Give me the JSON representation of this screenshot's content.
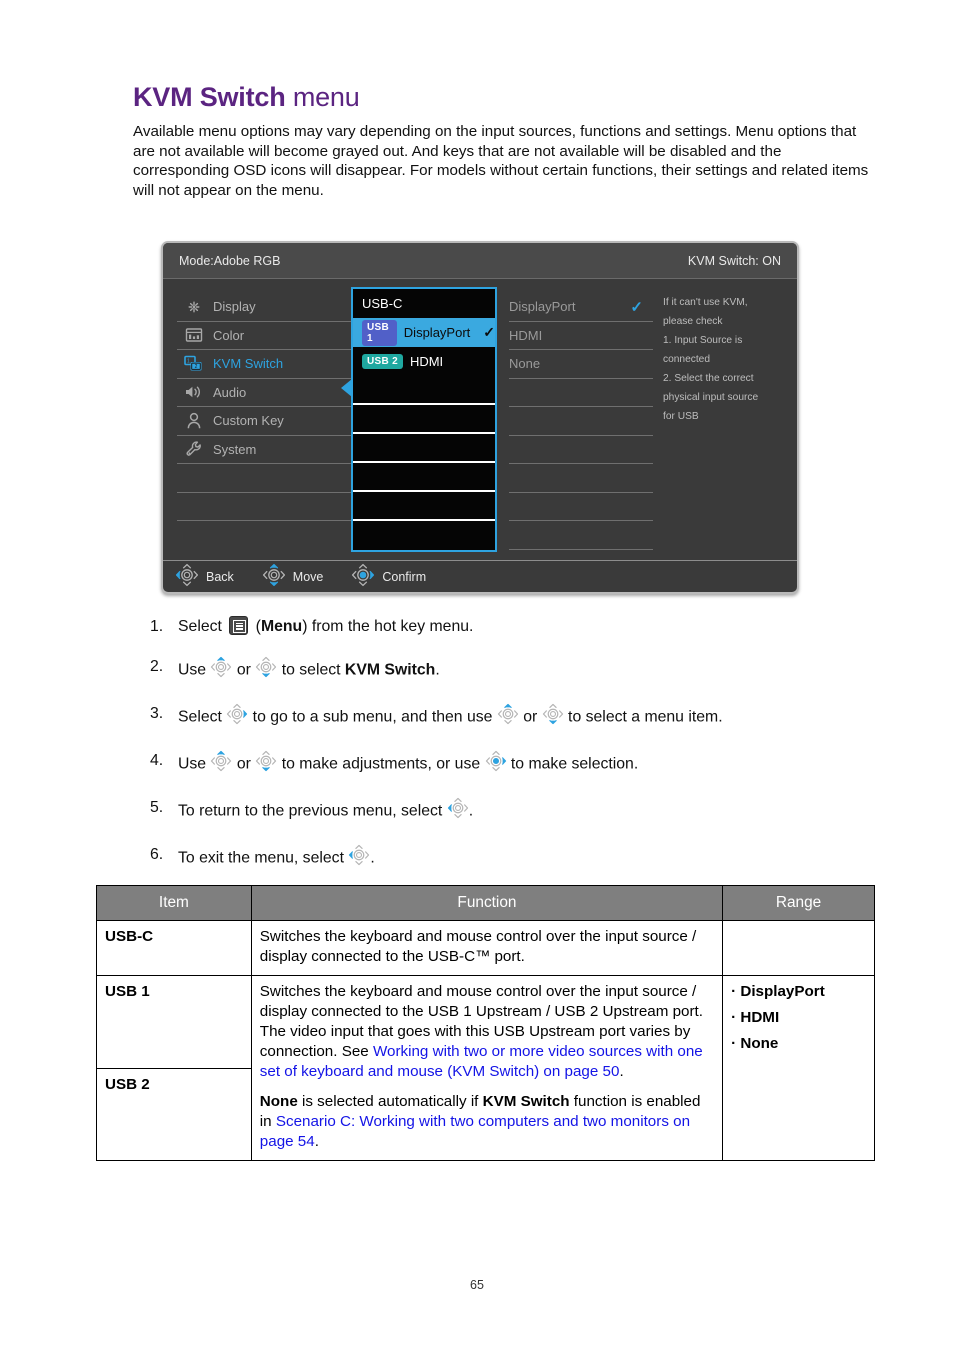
{
  "page": {
    "title_bold": "KVM Switch",
    "title_rest": " menu",
    "intro": "Available menu options may vary depending on the input sources, functions and settings. Menu options that are not available will become grayed out. And keys that are not available will be disabled and the corresponding OSD icons will disappear. For models without certain functions, their settings and related items will not appear on the menu.",
    "number": "65"
  },
  "osd": {
    "mode_label": "Mode:Adobe RGB",
    "kvm_status": "KVM Switch: ON",
    "sidebar": [
      {
        "label": "Display",
        "icon": "brightness-icon",
        "active": false
      },
      {
        "label": "Color",
        "icon": "color-chart-icon",
        "active": false
      },
      {
        "label": "KVM Switch",
        "icon": "kvm-monitors-icon",
        "active": true
      },
      {
        "label": "Audio",
        "icon": "speaker-icon",
        "active": false
      },
      {
        "label": "Custom Key",
        "icon": "person-icon",
        "active": false
      },
      {
        "label": "System",
        "icon": "wrench-icon",
        "active": false
      }
    ],
    "middle_items": [
      {
        "badge": "",
        "label": "USB-C",
        "selected": false,
        "check": false
      },
      {
        "badge": "USB 1",
        "badge_style": "u1",
        "label": "DisplayPort",
        "selected": true,
        "check": true
      },
      {
        "badge": "USB 2",
        "badge_style": "u2",
        "label": "HDMI",
        "selected": false,
        "check": false
      }
    ],
    "right_items": [
      {
        "label": "DisplayPort",
        "check": true
      },
      {
        "label": "HDMI",
        "check": false
      },
      {
        "label": "None",
        "check": false
      }
    ],
    "hint_lines": [
      "If it can't use KVM,",
      "please check",
      "1. Input Source is",
      "connected",
      "2. Select the correct",
      "physical input source",
      "for USB"
    ],
    "bottom_actions": [
      {
        "label": "Back",
        "key": "left"
      },
      {
        "label": "Move",
        "key": "updown"
      },
      {
        "label": "Confirm",
        "key": "center"
      }
    ],
    "colors": {
      "accent": "#2ea3e0",
      "selected_row": "#3aa9e0",
      "usb1_badge": "#5160c8",
      "usb2_badge": "#1fa8a0",
      "panel_bg": "#3a3a3a"
    }
  },
  "steps": [
    {
      "num": "1.",
      "parts": [
        {
          "t": "text",
          "v": "Select "
        },
        {
          "t": "menuicon"
        },
        {
          "t": "text",
          "v": " ("
        },
        {
          "t": "bold",
          "v": "Menu"
        },
        {
          "t": "text",
          "v": ") from the hot key menu."
        }
      ]
    },
    {
      "num": "2.",
      "parts": [
        {
          "t": "text",
          "v": "Use "
        },
        {
          "t": "ctl",
          "v": "up"
        },
        {
          "t": "text",
          "v": " or "
        },
        {
          "t": "ctl",
          "v": "down"
        },
        {
          "t": "text",
          "v": " to select "
        },
        {
          "t": "bold",
          "v": "KVM Switch"
        },
        {
          "t": "text",
          "v": "."
        }
      ]
    },
    {
      "num": "3.",
      "parts": [
        {
          "t": "text",
          "v": "Select "
        },
        {
          "t": "ctl",
          "v": "right"
        },
        {
          "t": "text",
          "v": " to go to a sub menu, and then use "
        },
        {
          "t": "ctl",
          "v": "up"
        },
        {
          "t": "text",
          "v": " or "
        },
        {
          "t": "ctl",
          "v": "down"
        },
        {
          "t": "text",
          "v": " to select a menu item."
        }
      ]
    },
    {
      "num": "4.",
      "parts": [
        {
          "t": "text",
          "v": "Use "
        },
        {
          "t": "ctl",
          "v": "up"
        },
        {
          "t": "text",
          "v": " or "
        },
        {
          "t": "ctl",
          "v": "down"
        },
        {
          "t": "text",
          "v": " to make adjustments, or use "
        },
        {
          "t": "ctl",
          "v": "center"
        },
        {
          "t": "text",
          "v": " to make selection."
        }
      ]
    },
    {
      "num": "5.",
      "parts": [
        {
          "t": "text",
          "v": "To return to the previous menu, select "
        },
        {
          "t": "ctl",
          "v": "left"
        },
        {
          "t": "text",
          "v": "."
        }
      ]
    },
    {
      "num": "6.",
      "parts": [
        {
          "t": "text",
          "v": "To exit the menu, select "
        },
        {
          "t": "ctl",
          "v": "left"
        },
        {
          "t": "text",
          "v": "."
        }
      ]
    }
  ],
  "table": {
    "headers": [
      "Item",
      "Function",
      "Range"
    ],
    "rows": [
      {
        "item": "USB-C",
        "function_parts": [
          {
            "t": "text",
            "v": "Switches the keyboard and mouse control over the input source / display connected to the USB-C™ port."
          }
        ],
        "range": []
      },
      {
        "item": "USB 1",
        "item2": "USB 2",
        "function_parts": [
          {
            "t": "para",
            "parts": [
              {
                "t": "text",
                "v": "Switches the keyboard and mouse control over the input source / display connected to the USB 1 Upstream / USB 2 Upstream port. The video input that goes with this USB Upstream port varies by connection. See "
              },
              {
                "t": "link",
                "v": "Working with two or more video sources with one set of keyboard and mouse (KVM Switch) on page 50"
              },
              {
                "t": "text",
                "v": "."
              }
            ]
          },
          {
            "t": "para",
            "parts": [
              {
                "t": "bold",
                "v": "None"
              },
              {
                "t": "text",
                "v": " is selected automatically if "
              },
              {
                "t": "bold",
                "v": "KVM Switch"
              },
              {
                "t": "text",
                "v": " function is enabled in "
              },
              {
                "t": "link",
                "v": "Scenario C: Working with two computers and two monitors on page 54"
              },
              {
                "t": "text",
                "v": "."
              }
            ]
          }
        ],
        "range": [
          "· DisplayPort",
          "· HDMI",
          "· None"
        ]
      }
    ]
  }
}
